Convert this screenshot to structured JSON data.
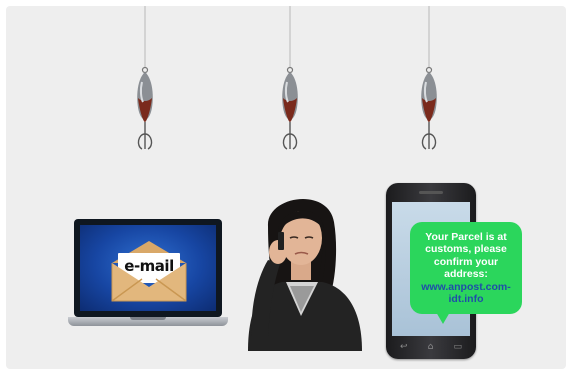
{
  "sms": {
    "message": "Your Parcel is at customs, please confirm your address:",
    "url": "www.anpost.com-idt.info"
  },
  "laptop": {
    "email_label": "e-mail"
  },
  "icons": [
    "fishing-lure-icon",
    "envelope-icon",
    "laptop-icon",
    "smartphone-icon",
    "person-on-phone-icon"
  ],
  "colors": {
    "background": "#eeeeee",
    "bubble": "#2bd65c",
    "url_text": "#1f4fa8",
    "laptop_screen": "#1746a3",
    "envelope": "#e2b77d"
  }
}
